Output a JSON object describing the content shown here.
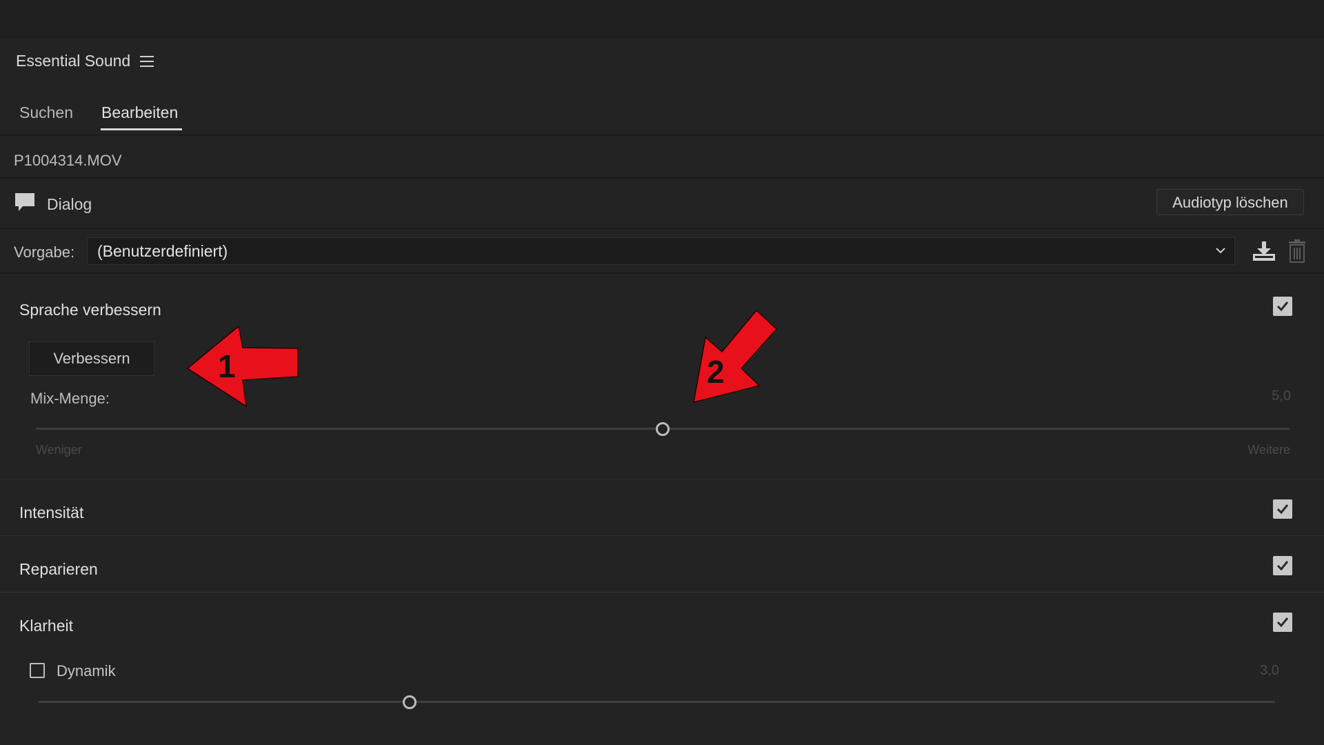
{
  "panel": {
    "title": "Essential Sound"
  },
  "tabs": [
    {
      "label": "Suchen",
      "active": false
    },
    {
      "label": "Bearbeiten",
      "active": true
    }
  ],
  "clip": {
    "filename": "P1004314.MOV"
  },
  "audio_type": {
    "label": "Dialog",
    "clear_button": "Audiotyp löschen",
    "icon": "speech-bubble-icon"
  },
  "preset": {
    "label": "Vorgabe:",
    "value": "(Benutzerdefiniert)"
  },
  "sections": {
    "speech": {
      "title": "Sprache verbessern",
      "checked": true,
      "button": "Verbessern",
      "mix_label": "Mix-Menge:",
      "mix_value": "5,0",
      "slider_min": "Weniger",
      "slider_max": "Weitere",
      "slider_fraction": 0.5
    },
    "intensity": {
      "title": "Intensität",
      "checked": true
    },
    "repair": {
      "title": "Reparieren",
      "checked": true
    },
    "clarity": {
      "title": "Klarheit",
      "checked": true,
      "dynamics_label": "Dynamik",
      "dynamics_checked": false,
      "dynamics_value": "3,0",
      "dynamics_fraction": 0.3
    }
  },
  "annotations": {
    "arrow1": "1",
    "arrow2": "2",
    "color": "#e8111b"
  },
  "colors": {
    "background": "#232323",
    "arrow": "#e8111b"
  }
}
